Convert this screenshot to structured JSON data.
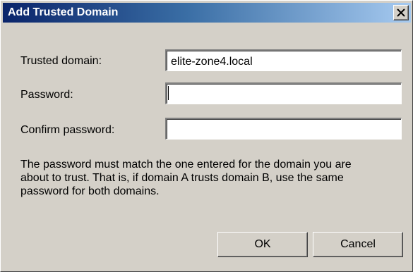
{
  "window": {
    "title": "Add Trusted Domain",
    "close_label": "×"
  },
  "form": {
    "trusted_domain_label": "Trusted domain:",
    "trusted_domain_value": "elite-zone4.local",
    "password_label": "Password:",
    "password_value": "",
    "confirm_label": "Confirm password:",
    "confirm_value": ""
  },
  "info": {
    "line1": "The password must match the one entered for the domain you are",
    "line2": "about to trust. That is, if domain A trusts domain B, use the same",
    "line3": "password for both domains."
  },
  "buttons": {
    "ok": "OK",
    "cancel": "Cancel"
  },
  "colors": {
    "titlebar_start": "#0a246a",
    "titlebar_end": "#a6caf0",
    "dialog_bg": "#d4d0c8"
  }
}
